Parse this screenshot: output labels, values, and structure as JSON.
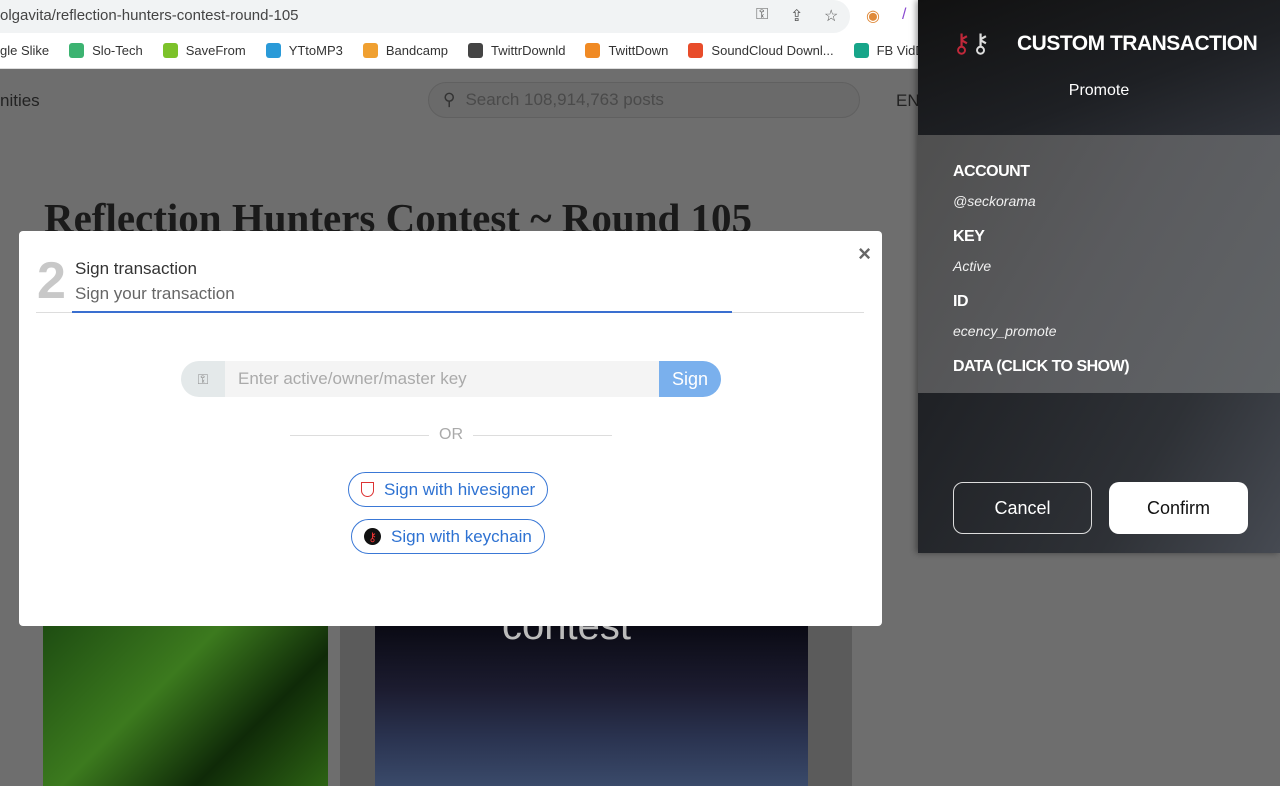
{
  "browser": {
    "url": "olgavita/reflection-hunters-contest-round-105",
    "bookmarks": [
      {
        "label": "gle Slike",
        "icon": "image-icon",
        "color": "#ffffff"
      },
      {
        "label": "Slo-Tech",
        "icon": "monitor-icon",
        "color": "#3cb371"
      },
      {
        "label": "SaveFrom",
        "icon": "download-arrow-icon",
        "color": "#7cc22a"
      },
      {
        "label": "YTtoMP3",
        "icon": "cloud-download-icon",
        "color": "#2a9ad8"
      },
      {
        "label": "Bandcamp",
        "icon": "download-circle-icon",
        "color": "#f0a030"
      },
      {
        "label": "TwittrDownld",
        "icon": "globe-icon",
        "color": "#444444"
      },
      {
        "label": "TwittDown",
        "icon": "download-box-icon",
        "color": "#f08a24"
      },
      {
        "label": "SoundCloud Downl...",
        "icon": "download-tray-icon",
        "color": "#e84c2a"
      },
      {
        "label": "FB VidD",
        "icon": "facebook-icon",
        "color": "#17a589"
      }
    ]
  },
  "site": {
    "nav_partial": "nities",
    "search_placeholder": "Search 108,914,763 posts",
    "lang": "EN",
    "post_title": "Reflection Hunters Contest ~ Round 105",
    "image_text": "contest"
  },
  "modal": {
    "step": "2",
    "title": "Sign transaction",
    "subtitle": "Sign your transaction",
    "key_placeholder": "Enter active/owner/master key",
    "sign_label": "Sign",
    "or_label": "OR",
    "hivesigner_label": "Sign with hivesigner",
    "keychain_label": "Sign with keychain",
    "close": "×"
  },
  "keychain": {
    "title": "CUSTOM TRANSACTION",
    "subtitle": "Promote",
    "fields": [
      {
        "label": "ACCOUNT",
        "value": "@seckorama"
      },
      {
        "label": "KEY",
        "value": "Active"
      },
      {
        "label": "ID",
        "value": "ecency_promote"
      }
    ],
    "data_label": "DATA (CLICK TO SHOW)",
    "cancel": "Cancel",
    "confirm": "Confirm"
  }
}
